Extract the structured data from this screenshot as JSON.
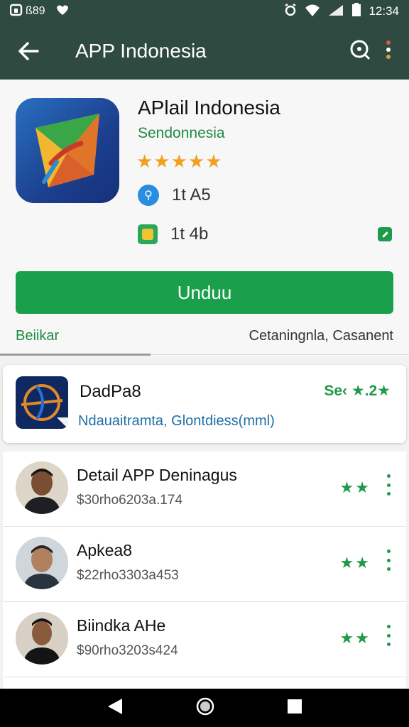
{
  "status": {
    "left_text": "ⓐ ꞩ 89",
    "time": "12:34"
  },
  "appbar": {
    "title": "APP Indonesia",
    "back_icon": "arrow-back-icon",
    "search_icon": "search-icon",
    "menu_icon": "more-vert-icon"
  },
  "app": {
    "name": "APlail Indonesia",
    "developer": "Sendonnesia",
    "stars": "★★★★★",
    "meta1": "1t A5",
    "meta2": "1t 4b",
    "install_label": "Unduu",
    "tab_left": "Beiikar",
    "tab_right": "Cetaningnla, Casanent"
  },
  "featured": {
    "name": "DadPa8",
    "rating": "Se‹ ★.2★",
    "description": "Ndauaitramta, Glontdiess(mml)"
  },
  "list": [
    {
      "name": "Detail APP Deninagus",
      "sub": "$30rho6203a.174",
      "stars": "★★"
    },
    {
      "name": "Apkea8",
      "sub": "$22rho3303a453",
      "stars": "★★"
    },
    {
      "name": "Biindka AHe",
      "sub": "$90rho3203s424",
      "stars": "★★"
    }
  ],
  "colors": {
    "appbar": "#2f4a40",
    "install": "#1aa04a",
    "accent_green": "#1f8a45",
    "star_gold": "#f0a020",
    "link_blue": "#1d6fa8"
  }
}
